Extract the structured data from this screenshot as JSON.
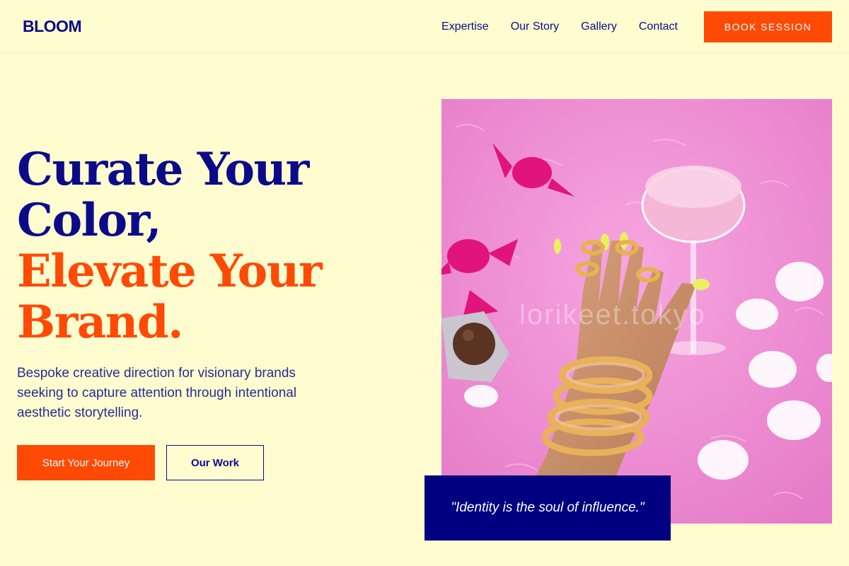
{
  "header": {
    "logo": "BLOOM",
    "nav": [
      "Expertise",
      "Our Story",
      "Gallery",
      "Contact"
    ],
    "cta": "BOOK SESSION"
  },
  "hero": {
    "title_lines": [
      "Curate Your",
      "Color,",
      "Elevate Your",
      "Brand."
    ],
    "subtitle": "Bespoke creative direction for visionary brands seeking to capture attention through intentional aesthetic storytelling.",
    "primary_button": "Start Your Journey",
    "secondary_button": "Our Work",
    "quote": "\"Identity is the soul of influence.\"",
    "image_watermark": "lorikeet.tokyo"
  },
  "colors": {
    "background": "#fffdd0",
    "navy": "#0b0b8a",
    "accent": "#ff4a05",
    "quote_bg": "#000080",
    "image_bg": "#f08ad2"
  }
}
